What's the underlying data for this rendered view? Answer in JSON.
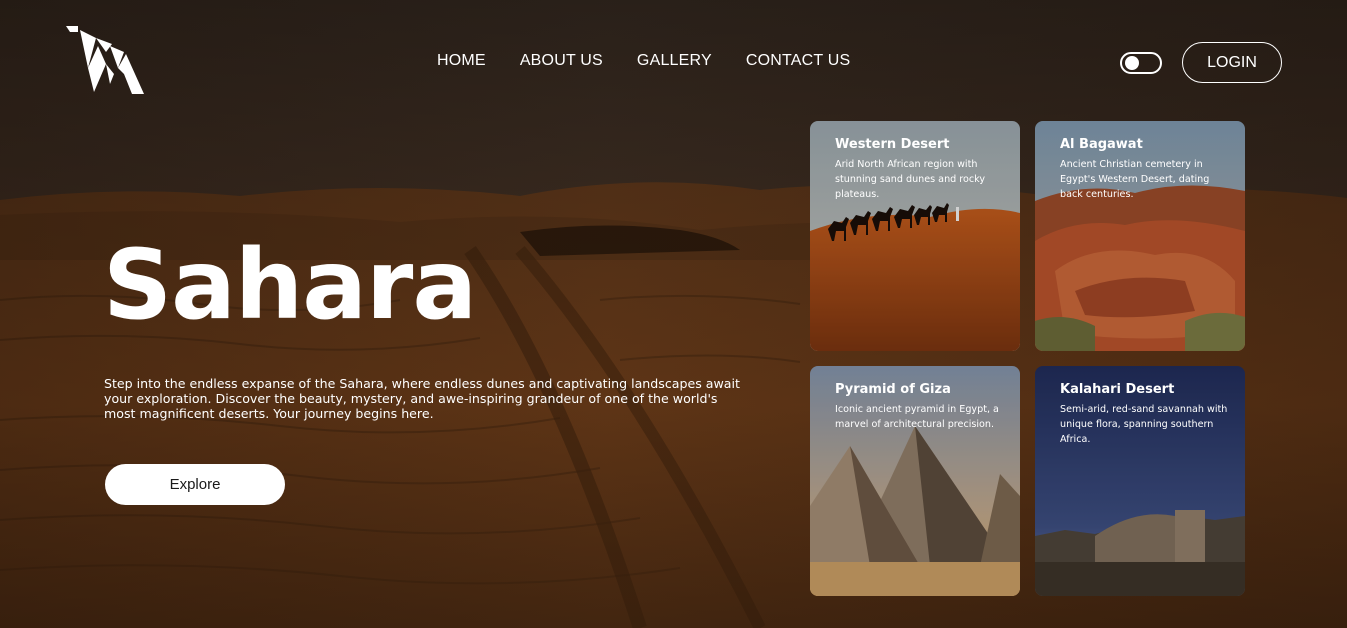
{
  "nav": {
    "items": [
      {
        "label": "HOME"
      },
      {
        "label": "ABOUT US"
      },
      {
        "label": "GALLERY"
      },
      {
        "label": "CONTACT US"
      }
    ],
    "login_label": "LOGIN"
  },
  "hero": {
    "title": "Sahara",
    "description": "Step into the endless expanse of the Sahara, where endless dunes and captivating landscapes await your exploration. Discover the beauty, mystery, and awe-inspiring grandeur of one of the world's most magnificent deserts. Your journey begins here.",
    "button_label": "Explore"
  },
  "cards": [
    {
      "title": "Western Desert",
      "description": "Arid North African region with stunning sand dunes and rocky plateaus."
    },
    {
      "title": "Al Bagawat",
      "description": "Ancient Christian cemetery in Egypt's Western Desert, dating back centuries."
    },
    {
      "title": "Pyramid of Giza",
      "description": "Iconic ancient pyramid in Egypt, a marvel of architectural precision."
    },
    {
      "title": "Kalahari Desert",
      "description": "Semi-arid, red-sand savannah with unique flora, spanning southern Africa."
    }
  ],
  "icons": {
    "logo": "camel-origami-logo",
    "theme_toggle": "toggle-switch"
  }
}
